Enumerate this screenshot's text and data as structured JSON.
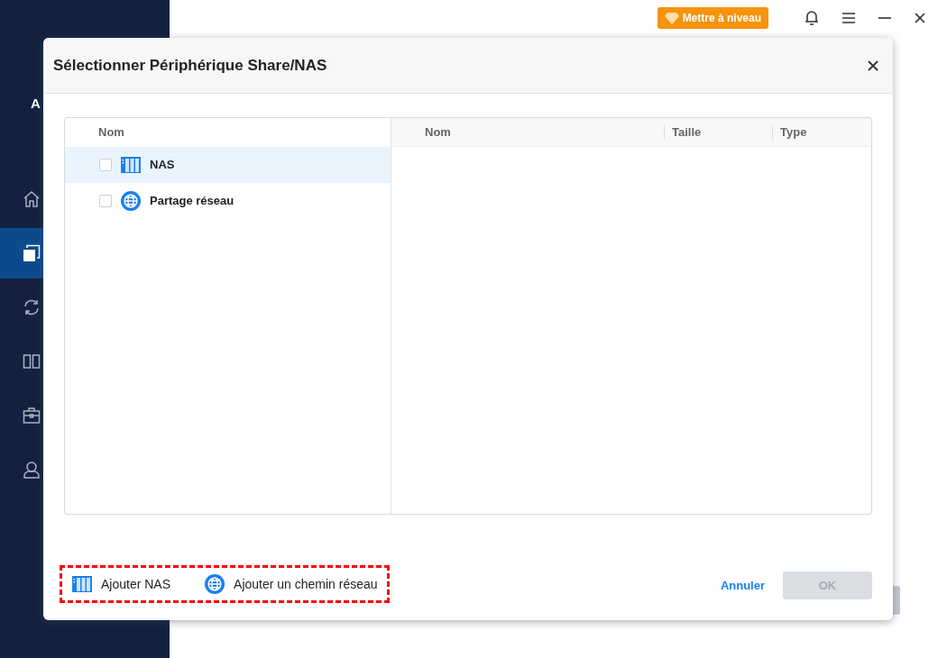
{
  "app": {
    "sidebar": {
      "brand": "A",
      "items": [
        {
          "kind": "home",
          "selected": false
        },
        {
          "kind": "backup",
          "selected": true
        },
        {
          "kind": "sync",
          "selected": false
        },
        {
          "kind": "clone",
          "selected": false
        },
        {
          "kind": "tools",
          "selected": false
        },
        {
          "kind": "account",
          "selected": false
        }
      ]
    },
    "top_bar": {
      "upgrade_button": "Mettre à niveau"
    }
  },
  "dialog": {
    "title": "Sélectionner Périphérique Share/NAS",
    "tree": {
      "column": "Nom",
      "items": [
        {
          "kind": "nas",
          "label": "NAS",
          "checked": false,
          "selected": true
        },
        {
          "kind": "network",
          "label": "Partage réseau",
          "checked": false,
          "selected": false
        }
      ]
    },
    "file_list": {
      "columns": [
        "Nom",
        "Taille",
        "Type"
      ]
    },
    "add_actions": [
      {
        "kind": "nas",
        "label": "Ajouter NAS"
      },
      {
        "kind": "network",
        "label": "Ajouter un chemin réseau"
      }
    ],
    "cancel_button": "Annuler",
    "ok_button": {
      "label": "OK",
      "disabled": true
    }
  }
}
